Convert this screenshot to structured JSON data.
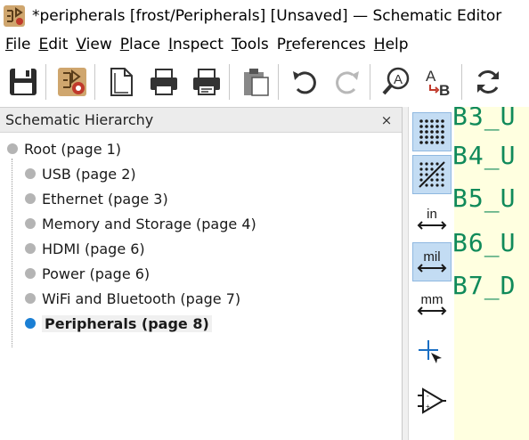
{
  "window": {
    "title": "*peripherals [frost/Peripherals] [Unsaved] — Schematic Editor"
  },
  "menu": [
    {
      "label": "File",
      "u": "F",
      "rest": "ile"
    },
    {
      "label": "Edit",
      "u": "E",
      "rest": "dit"
    },
    {
      "label": "View",
      "u": "V",
      "rest": "iew"
    },
    {
      "label": "Place",
      "u": "P",
      "rest": "lace"
    },
    {
      "label": "Inspect",
      "u": "I",
      "rest": "nspect"
    },
    {
      "label": "Tools",
      "u": "T",
      "rest": "ools"
    },
    {
      "label": "Preferences",
      "pre": "P",
      "u": "r",
      "rest": "eferences"
    },
    {
      "label": "Help",
      "u": "H",
      "rest": "elp"
    }
  ],
  "toolbar": {
    "icons": [
      "save-icon",
      "schematic-setup-icon",
      "page-settings-icon",
      "print-icon",
      "plot-icon",
      "paste-icon",
      "undo-icon",
      "redo-icon",
      "find-icon",
      "find-replace-icon",
      "refresh-icon"
    ]
  },
  "hierarchy": {
    "title": "Schematic Hierarchy",
    "close": "×",
    "root": "Root (page 1)",
    "children": [
      "USB (page 2)",
      "Ethernet (page 3)",
      "Memory and Storage (page 4)",
      "HDMI (page 6)",
      "Power (page 6)",
      "WiFi and Bluetooth (page 7)",
      "Peripherals (page 8)"
    ],
    "current": "Peripherals (page 8)"
  },
  "left_toolbar": {
    "units_in": "in",
    "units_mil": "mil",
    "units_mm": "mm"
  },
  "canvas": {
    "labels": [
      "B3_U",
      "B4_U",
      "B5_U",
      "B6_U",
      "B7_D"
    ]
  },
  "colors": {
    "accent": "#1b7fd4",
    "net_label": "#108a5a",
    "canvas_bg": "#ffffe0"
  }
}
